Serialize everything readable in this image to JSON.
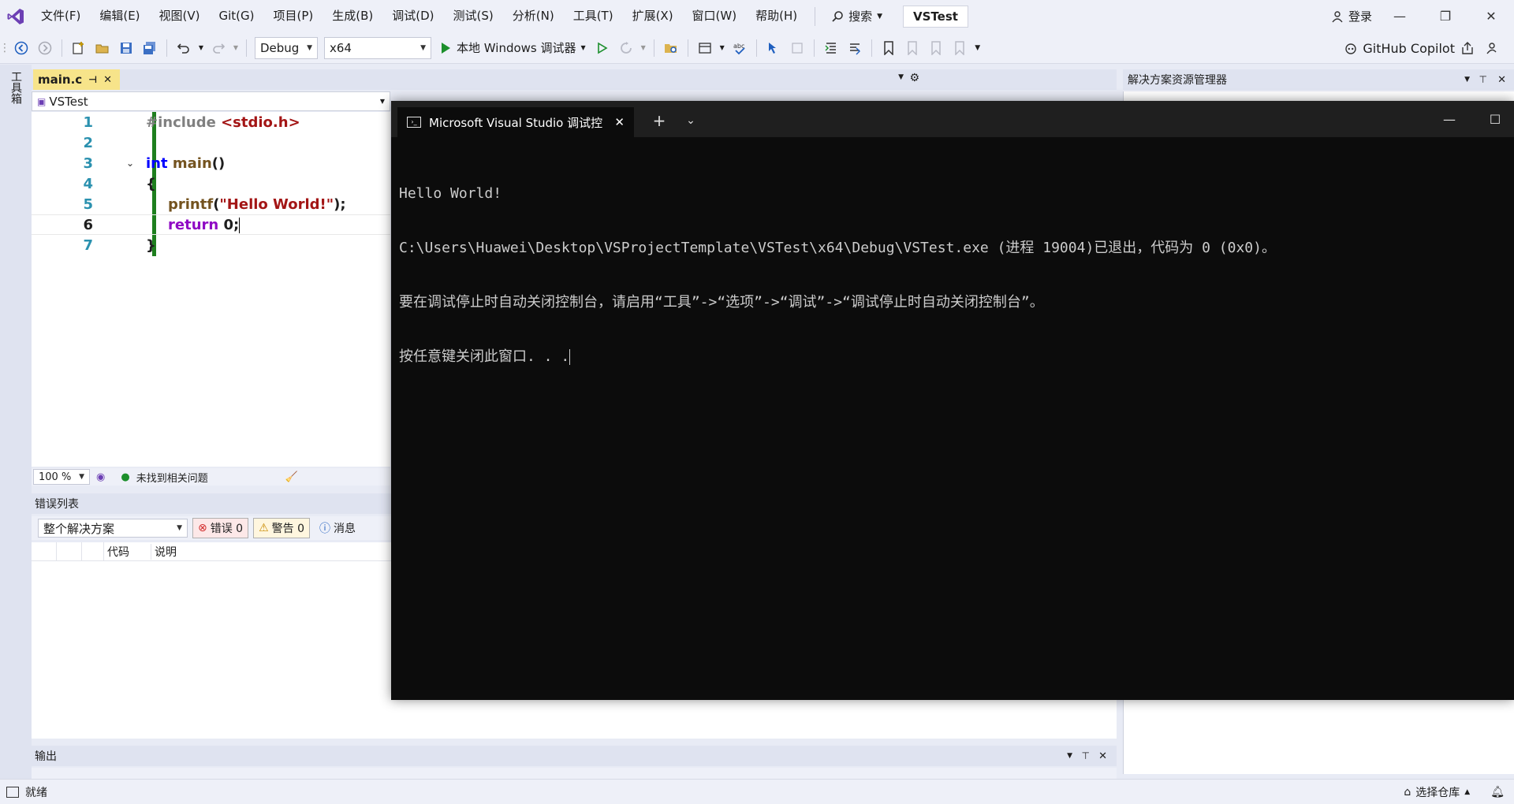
{
  "menubar": {
    "items": [
      "文件(F)",
      "编辑(E)",
      "视图(V)",
      "Git(G)",
      "项目(P)",
      "生成(B)",
      "调试(D)",
      "测试(S)",
      "分析(N)",
      "工具(T)",
      "扩展(X)",
      "窗口(W)",
      "帮助(H)"
    ],
    "search_label": "搜索",
    "solution_name": "VSTest",
    "login_label": "登录"
  },
  "toolbar": {
    "config_value": "Debug",
    "platform_value": "x64",
    "debugger_label": "本地 Windows 调试器",
    "copilot_label": "GitHub Copilot"
  },
  "left_strip": {
    "toolbox_label": "工具箱"
  },
  "editor": {
    "tab_label": "main.c",
    "nav_project": "VSTest",
    "lines": [
      {
        "num": "1"
      },
      {
        "num": "2"
      },
      {
        "num": "3"
      },
      {
        "num": "4"
      },
      {
        "num": "5"
      },
      {
        "num": "6"
      },
      {
        "num": "7"
      }
    ],
    "code": {
      "l1_include": "#include ",
      "l1_header": "<stdio.h>",
      "l3_int": "int",
      "l3_main": "main",
      "l3_paren": "()",
      "l4_brace": "{",
      "l5_printf": "printf",
      "l5_open": "(",
      "l5_str": "\"Hello World!\"",
      "l5_close": ");",
      "l6_return": "return",
      "l6_zero": "0;",
      "l7_brace": "}"
    },
    "zoom": "100 %",
    "status_text": "未找到相关问题"
  },
  "error_list": {
    "title": "错误列表",
    "scope": "整个解决方案",
    "errors_label": "错误 0",
    "warnings_label": "警告 0",
    "messages_label": "消息",
    "col_code": "代码",
    "col_desc": "说明"
  },
  "output": {
    "title": "输出"
  },
  "solution_explorer": {
    "title": "解决方案资源管理器"
  },
  "statusbar": {
    "ready": "就绪",
    "repo": "选择仓库"
  },
  "console": {
    "tab_title": "Microsoft Visual Studio 调试控",
    "lines": [
      "Hello World!",
      "C:\\Users\\Huawei\\Desktop\\VSProjectTemplate\\VSTest\\x64\\Debug\\VSTest.exe (进程 19004)已退出，代码为 0 (0x0)。",
      "要在调试停止时自动关闭控制台，请启用“工具”->“选项”->“调试”->“调试停止时自动关闭控制台”。",
      "按任意键关闭此窗口. . ."
    ]
  }
}
